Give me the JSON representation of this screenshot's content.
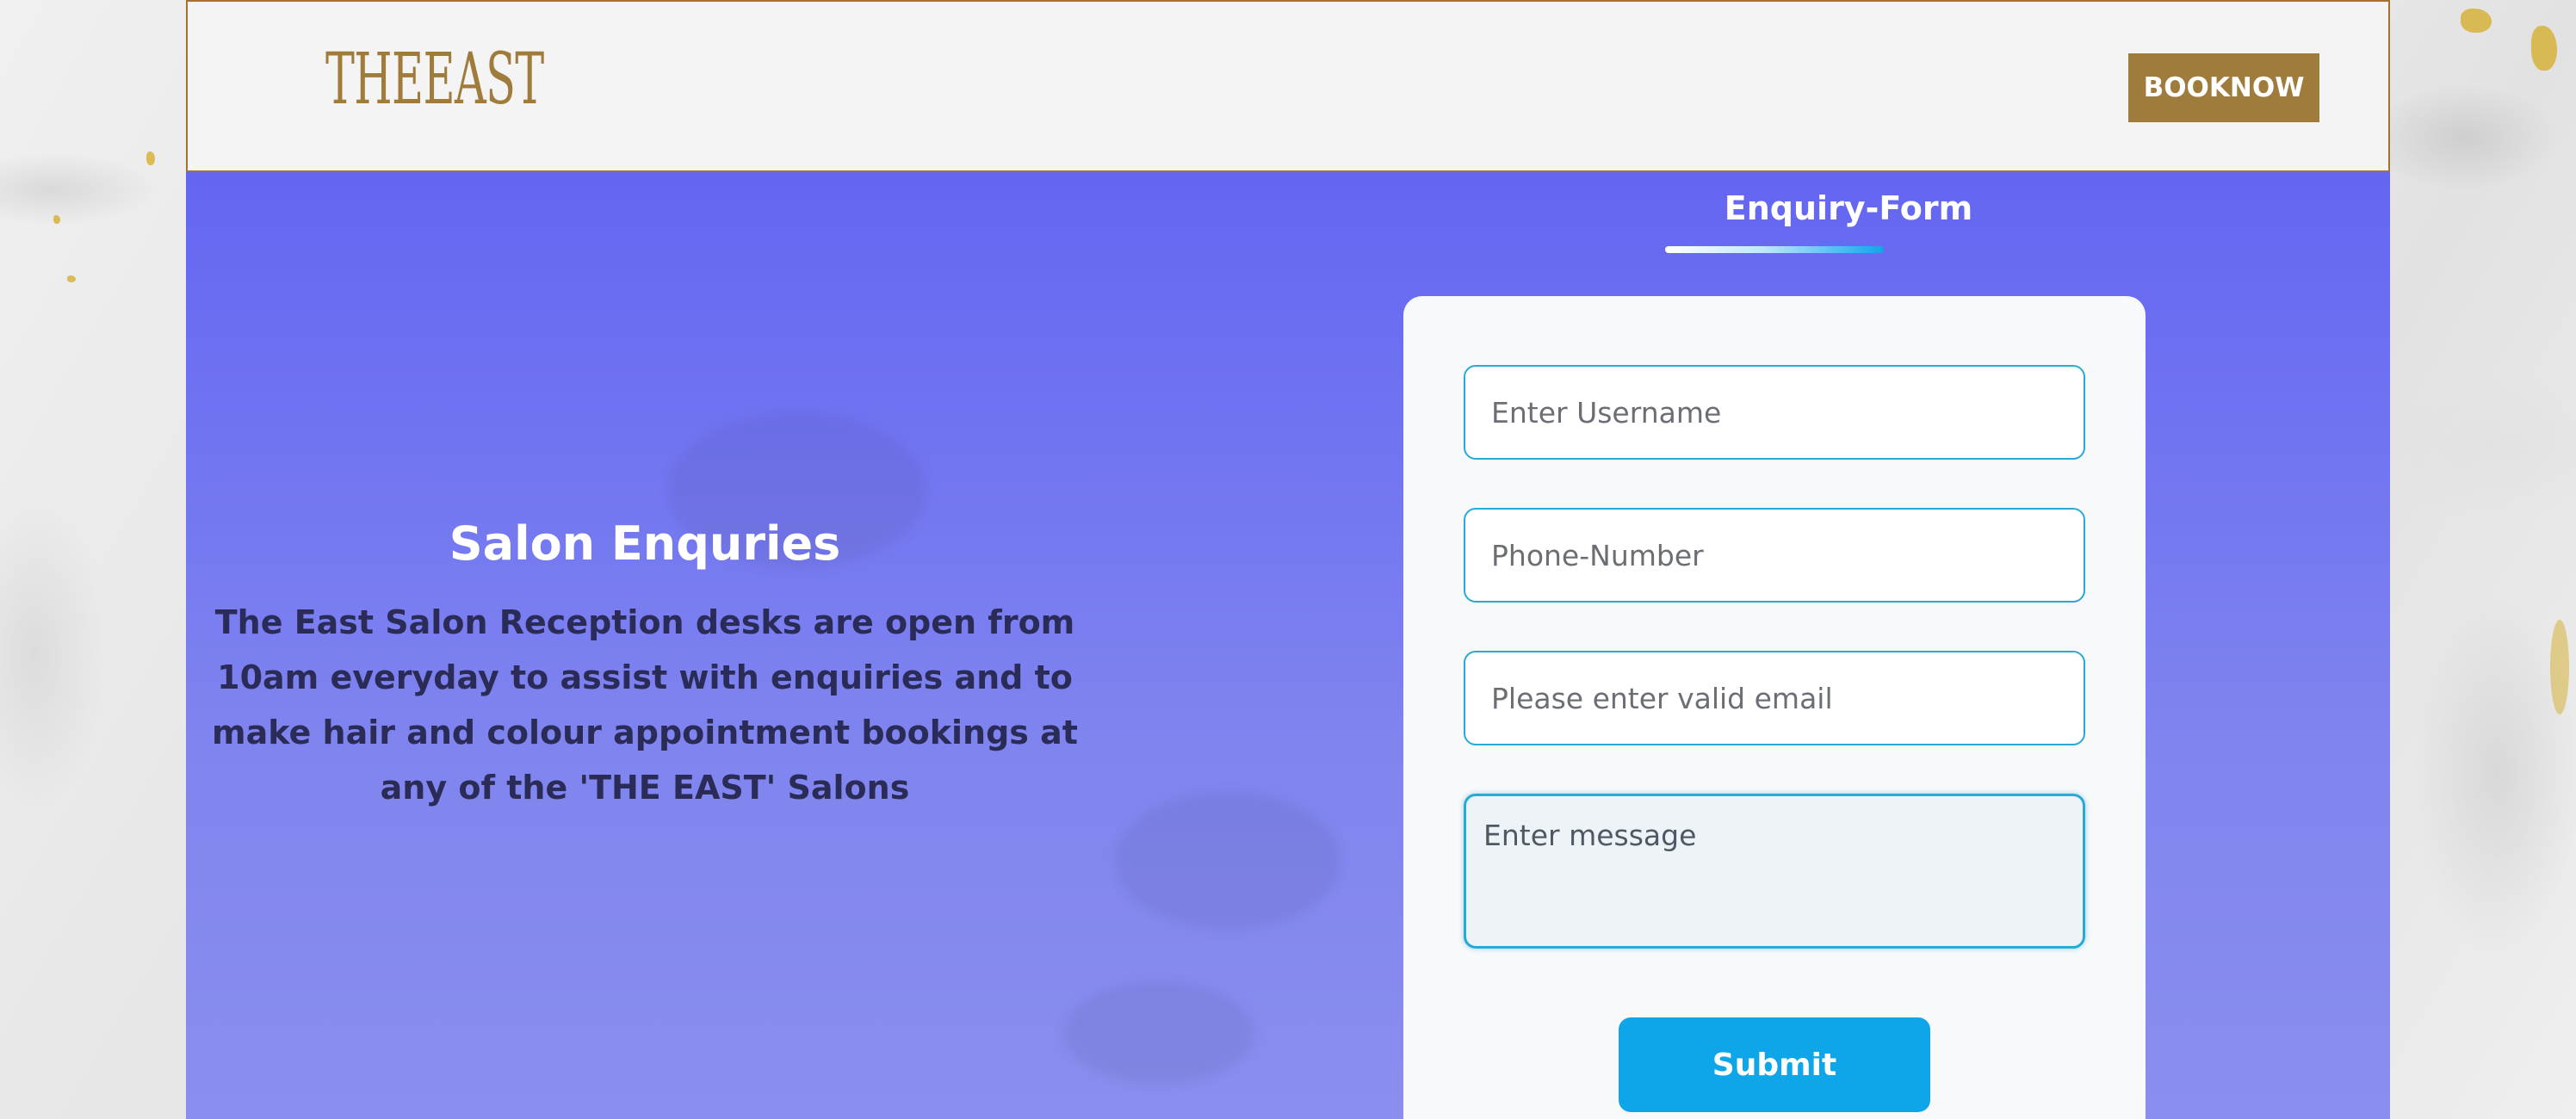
{
  "header": {
    "logo_text": "THEEAST",
    "book_button_label": "BOOKNOW"
  },
  "intro": {
    "title": "Salon Enquries",
    "description": "The East Salon Reception desks are open from 10am everyday to assist with enquiries and to make hair and colour appointment bookings at any of the 'THE EAST' Salons"
  },
  "form": {
    "title": "Enquiry-Form",
    "username_placeholder": "Enter Username",
    "phone_placeholder": "Phone-Number",
    "email_placeholder": "Please enter valid email",
    "message_placeholder": "Enter message",
    "submit_label": "Submit"
  },
  "colors": {
    "brand_gold": "#a07c3c",
    "hero_purple": "#6466f2",
    "accent_blue": "#0ea5e9"
  }
}
